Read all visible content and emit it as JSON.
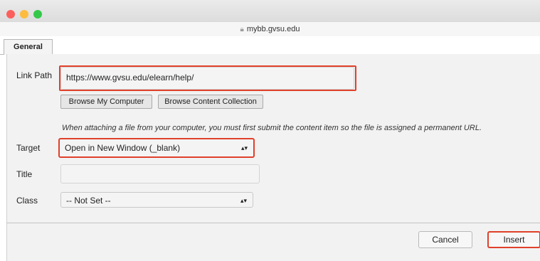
{
  "window": {
    "url": "mybb.gvsu.edu",
    "lock_icon": "lock-icon"
  },
  "tabs": [
    {
      "label": "General",
      "active": true
    }
  ],
  "form": {
    "link_path": {
      "label": "Link Path",
      "value": "https://www.gvsu.edu/elearn/help/"
    },
    "browse_my_computer": "Browse My Computer",
    "browse_content_collection": "Browse Content Collection",
    "attach_note": "When attaching a file from your computer, you must first submit the content item so the file is assigned a permanent URL.",
    "target": {
      "label": "Target",
      "selected": "Open in New Window (_blank)"
    },
    "title": {
      "label": "Title",
      "value": ""
    },
    "class": {
      "label": "Class",
      "selected": "-- Not Set --"
    }
  },
  "footer": {
    "cancel_label": "Cancel",
    "insert_label": "Insert"
  },
  "colors": {
    "highlight": "#e0402b",
    "panel": "#f2f2f2",
    "traffic_red": "#fc605c",
    "traffic_yellow": "#fdbc40",
    "traffic_green": "#34c84a"
  }
}
